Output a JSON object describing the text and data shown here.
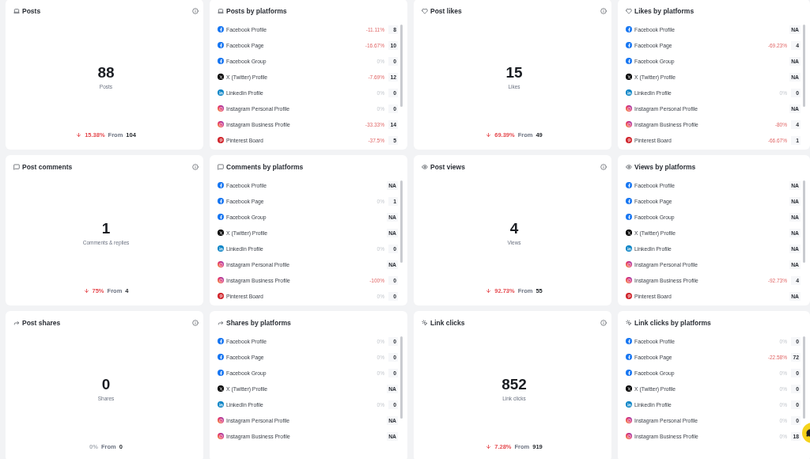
{
  "cards": [
    {
      "kind": "stat",
      "title": "Posts",
      "value": "88",
      "label": "Posts",
      "trend": {
        "negative": true,
        "percent": "15.38%",
        "from_label": "From",
        "from_value": "104"
      }
    },
    {
      "kind": "platforms",
      "title": "Posts by platforms",
      "rows": [
        {
          "kind": "facebook",
          "name": "Facebook Profile",
          "change": "-11.11%",
          "negative": true,
          "value": "8"
        },
        {
          "kind": "facebook",
          "name": "Facebook Page",
          "change": "-16.67%",
          "negative": true,
          "value": "10"
        },
        {
          "kind": "facebook",
          "name": "Facebook Group",
          "change": "0%",
          "negative": false,
          "value": "0"
        },
        {
          "kind": "x",
          "name": "X (Twitter) Profile",
          "change": "-7.69%",
          "negative": true,
          "value": "12"
        },
        {
          "kind": "linkedin",
          "name": "LinkedIn Profile",
          "change": "0%",
          "negative": false,
          "value": "0"
        },
        {
          "kind": "instagram",
          "name": "Instagram Personal Profile",
          "change": "0%",
          "negative": false,
          "value": "0"
        },
        {
          "kind": "instagram",
          "name": "Instagram Business Profile",
          "change": "-33.33%",
          "negative": true,
          "value": "14"
        },
        {
          "kind": "pinterest",
          "name": "Pinterest Board",
          "change": "-37.5%",
          "negative": true,
          "value": "5"
        }
      ]
    },
    {
      "kind": "stat",
      "title": "Post likes",
      "value": "15",
      "label": "Likes",
      "trend": {
        "negative": true,
        "percent": "69.39%",
        "from_label": "From",
        "from_value": "49"
      }
    },
    {
      "kind": "platforms",
      "title": "Likes by platforms",
      "rows": [
        {
          "kind": "facebook",
          "name": "Facebook Profile",
          "value": "NA"
        },
        {
          "kind": "facebook",
          "name": "Facebook Page",
          "change": "-69.23%",
          "negative": true,
          "value": "4"
        },
        {
          "kind": "facebook",
          "name": "Facebook Group",
          "value": "NA"
        },
        {
          "kind": "x",
          "name": "X (Twitter) Profile",
          "value": "NA"
        },
        {
          "kind": "linkedin",
          "name": "LinkedIn Profile",
          "change": "0%",
          "negative": false,
          "value": "0"
        },
        {
          "kind": "instagram",
          "name": "Instagram Personal Profile",
          "value": "NA"
        },
        {
          "kind": "instagram",
          "name": "Instagram Business Profile",
          "change": "-80%",
          "negative": true,
          "value": "4"
        },
        {
          "kind": "pinterest",
          "name": "Pinterest Board",
          "change": "-66.67%",
          "negative": true,
          "value": "1"
        }
      ]
    },
    {
      "kind": "stat",
      "title": "Post comments",
      "value": "1",
      "label": "Comments & replies",
      "trend": {
        "negative": true,
        "percent": "75%",
        "from_label": "From",
        "from_value": "4"
      }
    },
    {
      "kind": "platforms",
      "title": "Comments by platforms",
      "rows": [
        {
          "kind": "facebook",
          "name": "Facebook Profile",
          "value": "NA"
        },
        {
          "kind": "facebook",
          "name": "Facebook Page",
          "change": "0%",
          "negative": false,
          "value": "1"
        },
        {
          "kind": "facebook",
          "name": "Facebook Group",
          "value": "NA"
        },
        {
          "kind": "x",
          "name": "X (Twitter) Profile",
          "value": "NA"
        },
        {
          "kind": "linkedin",
          "name": "LinkedIn Profile",
          "change": "0%",
          "negative": false,
          "value": "0"
        },
        {
          "kind": "instagram",
          "name": "Instagram Personal Profile",
          "value": "NA"
        },
        {
          "kind": "instagram",
          "name": "Instagram Business Profile",
          "change": "-100%",
          "negative": true,
          "value": "0"
        },
        {
          "kind": "pinterest",
          "name": "Pinterest Board",
          "change": "0%",
          "negative": false,
          "value": "0"
        }
      ]
    },
    {
      "kind": "stat",
      "title": "Post views",
      "value": "4",
      "label": "Views",
      "trend": {
        "negative": true,
        "percent": "92.73%",
        "from_label": "From",
        "from_value": "55"
      }
    },
    {
      "kind": "platforms",
      "title": "Views by platforms",
      "rows": [
        {
          "kind": "facebook",
          "name": "Facebook Profile",
          "value": "NA"
        },
        {
          "kind": "facebook",
          "name": "Facebook Page",
          "value": "NA"
        },
        {
          "kind": "facebook",
          "name": "Facebook Group",
          "value": "NA"
        },
        {
          "kind": "x",
          "name": "X (Twitter) Profile",
          "value": "NA"
        },
        {
          "kind": "linkedin",
          "name": "LinkedIn Profile",
          "value": "NA"
        },
        {
          "kind": "instagram",
          "name": "Instagram Personal Profile",
          "value": "NA"
        },
        {
          "kind": "instagram",
          "name": "Instagram Business Profile",
          "change": "-92.73%",
          "negative": true,
          "value": "4"
        },
        {
          "kind": "pinterest",
          "name": "Pinterest Board",
          "value": "NA"
        }
      ]
    },
    {
      "kind": "stat",
      "title": "Post shares",
      "value": "0",
      "label": "Shares",
      "trend": {
        "negative": false,
        "percent": "0%",
        "from_label": "From",
        "from_value": "0"
      }
    },
    {
      "kind": "platforms",
      "title": "Shares by platforms",
      "rows": [
        {
          "kind": "facebook",
          "name": "Facebook Profile",
          "change": "0%",
          "negative": false,
          "value": "0"
        },
        {
          "kind": "facebook",
          "name": "Facebook Page",
          "change": "0%",
          "negative": false,
          "value": "0"
        },
        {
          "kind": "facebook",
          "name": "Facebook Group",
          "change": "0%",
          "negative": false,
          "value": "0"
        },
        {
          "kind": "x",
          "name": "X (Twitter) Profile",
          "value": "NA"
        },
        {
          "kind": "linkedin",
          "name": "LinkedIn Profile",
          "change": "0%",
          "negative": false,
          "value": "0"
        },
        {
          "kind": "instagram",
          "name": "Instagram Personal Profile",
          "value": "NA"
        },
        {
          "kind": "instagram",
          "name": "Instagram Business Profile",
          "value": "NA"
        }
      ]
    },
    {
      "kind": "stat",
      "title": "Link clicks",
      "value": "852",
      "label": "Link clicks",
      "trend": {
        "negative": true,
        "percent": "7.28%",
        "from_label": "From",
        "from_value": "919"
      }
    },
    {
      "kind": "platforms",
      "title": "Link clicks by platforms",
      "rows": [
        {
          "kind": "facebook",
          "name": "Facebook Profile",
          "change": "0%",
          "negative": false,
          "value": "0"
        },
        {
          "kind": "facebook",
          "name": "Facebook Page",
          "change": "-22.58%",
          "negative": true,
          "value": "72"
        },
        {
          "kind": "facebook",
          "name": "Facebook Group",
          "change": "0%",
          "negative": false,
          "value": "0"
        },
        {
          "kind": "x",
          "name": "X (Twitter) Profile",
          "change": "0%",
          "negative": false,
          "value": "0"
        },
        {
          "kind": "linkedin",
          "name": "LinkedIn Profile",
          "change": "0%",
          "negative": false,
          "value": "0"
        },
        {
          "kind": "instagram",
          "name": "Instagram Personal Profile",
          "change": "0%",
          "negative": false,
          "value": "0"
        },
        {
          "kind": "instagram",
          "name": "Instagram Business Profile",
          "change": "0%",
          "negative": false,
          "value": "18"
        }
      ]
    }
  ]
}
